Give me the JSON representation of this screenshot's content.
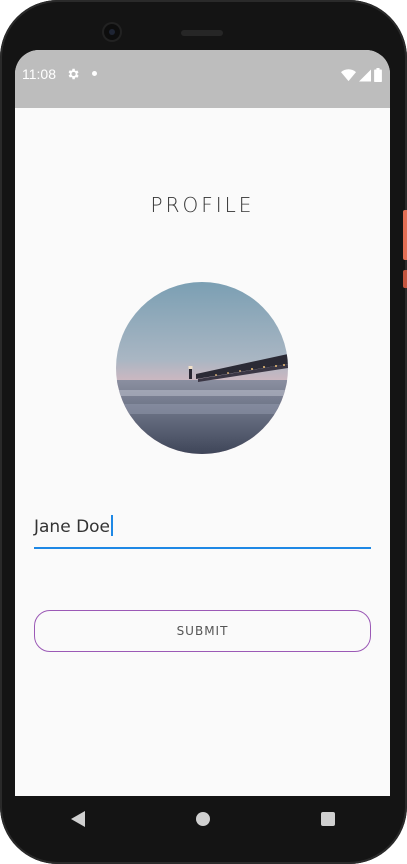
{
  "status_bar": {
    "time": "11:08",
    "icons": [
      "gear-icon",
      "notification-dot-icon",
      "wifi-icon",
      "signal-icon",
      "battery-icon"
    ]
  },
  "page": {
    "title": "PROFILE"
  },
  "profile": {
    "avatar_image": "pier-at-sunset-photo",
    "name_value": "Jane Doe"
  },
  "form": {
    "submit_label": "SUBMIT"
  },
  "nav": {
    "buttons": [
      "back-icon",
      "home-icon",
      "recents-icon"
    ]
  },
  "colors": {
    "accent": "#1e88e5",
    "button_border": "#9b59b6",
    "status_bar": "#bdbdbd",
    "screen_background": "#fafafa",
    "device_frame": "#141414"
  }
}
